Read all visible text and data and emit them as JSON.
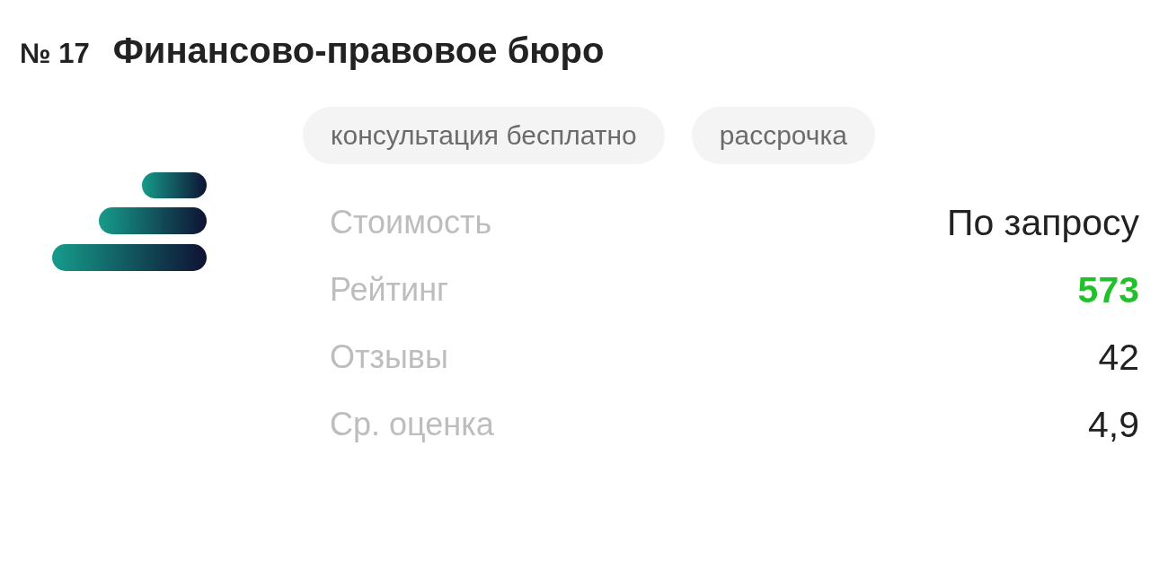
{
  "number": "№ 17",
  "title": "Финансово-правовое бюро",
  "tags": [
    "консультация бесплатно",
    "рассрочка"
  ],
  "rows": [
    {
      "label": "Стоимость",
      "value": "По запросу",
      "kind": "plain"
    },
    {
      "label": "Рейтинг",
      "value": "573",
      "kind": "rating"
    },
    {
      "label": "Отзывы",
      "value": "42",
      "kind": "plain"
    },
    {
      "label": "Ср. оценка",
      "value": "4,9",
      "kind": "plain"
    }
  ]
}
